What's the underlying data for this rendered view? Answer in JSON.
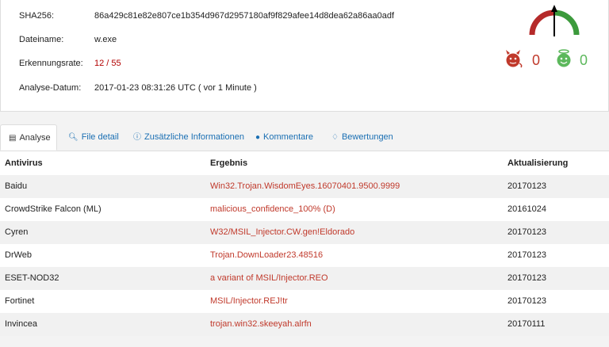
{
  "summary": {
    "sha256_label": "SHA256:",
    "sha256_value": "86a429c81e82e807ce1b354d967d2957180af9f829afee14d8dea62a86aa0adf",
    "filename_label": "Dateiname:",
    "filename_value": "w.exe",
    "detection_label": "Erkennungsrate:",
    "detection_value": "12 / 55",
    "date_label": "Analyse-Datum:",
    "date_value": "2017-01-23 08:31:26 UTC ( vor 1 Minute )"
  },
  "votes": {
    "malicious_count": "0",
    "harmless_count": "0",
    "colors": {
      "malicious": "#c0392b",
      "harmless": "#5cb85c",
      "gauge_red": "#b52a2a",
      "gauge_green": "#3c9a3c"
    }
  },
  "tabs": [
    {
      "label": "Analyse",
      "icon": "table-icon"
    },
    {
      "label": "File detail",
      "icon": "search-icon"
    },
    {
      "label": "Zusätzliche Informationen",
      "icon": "info-icon"
    },
    {
      "label": "Kommentare",
      "icon": "comment-icon"
    },
    {
      "label": "Bewertungen",
      "icon": "thumbs-icon"
    }
  ],
  "table": {
    "headers": {
      "antivirus": "Antivirus",
      "result": "Ergebnis",
      "update": "Aktualisierung"
    },
    "rows": [
      {
        "antivirus": "Baidu",
        "result": "Win32.Trojan.WisdomEyes.16070401.9500.9999",
        "update": "20170123"
      },
      {
        "antivirus": "CrowdStrike Falcon (ML)",
        "result": "malicious_confidence_100% (D)",
        "update": "20161024"
      },
      {
        "antivirus": "Cyren",
        "result": "W32/MSIL_Injector.CW.gen!Eldorado",
        "update": "20170123"
      },
      {
        "antivirus": "DrWeb",
        "result": "Trojan.DownLoader23.48516",
        "update": "20170123"
      },
      {
        "antivirus": "ESET-NOD32",
        "result": "a variant of MSIL/Injector.REO",
        "update": "20170123"
      },
      {
        "antivirus": "Fortinet",
        "result": "MSIL/Injector.REJ!tr",
        "update": "20170123"
      },
      {
        "antivirus": "Invincea",
        "result": "trojan.win32.skeeyah.alrfn",
        "update": "20170111"
      }
    ]
  }
}
